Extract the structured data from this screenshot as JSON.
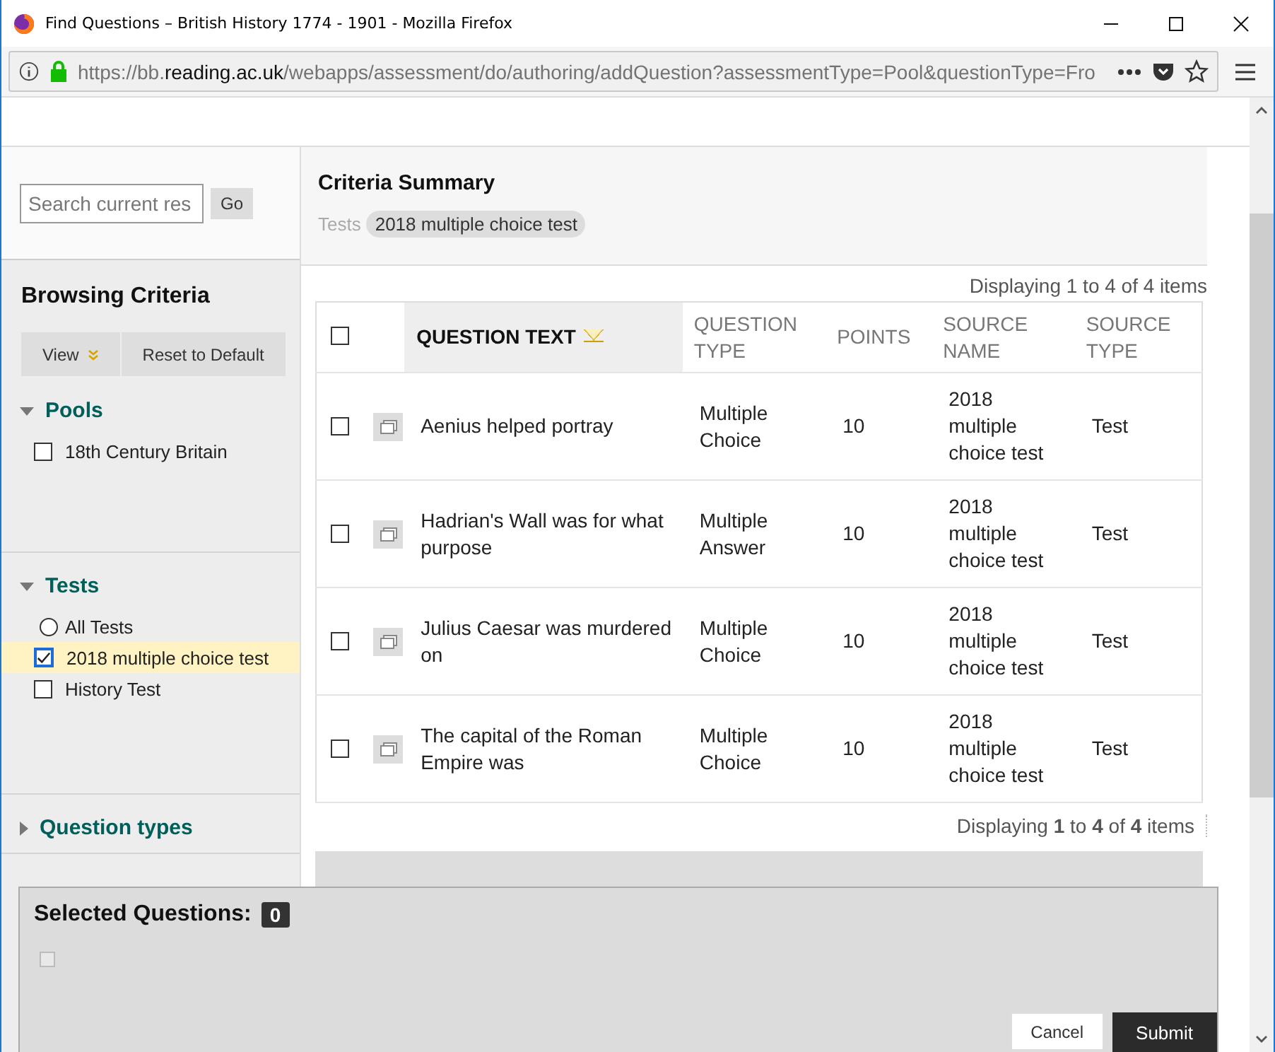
{
  "window": {
    "title": "Find Questions – British History 1774 - 1901 - Mozilla Firefox"
  },
  "address_bar": {
    "url_start": "https://bb.",
    "url_domain": "reading.ac.uk",
    "url_rest": "/webapps/assessment/do/authoring/addQuestion?assessmentType=Pool&questionType=Fro"
  },
  "sidebar": {
    "search": {
      "placeholder": "Search current res",
      "button": "Go"
    },
    "title": "Browsing Criteria",
    "buttons": [
      {
        "label": "View",
        "kind": "menu"
      },
      {
        "label": "Reset to Default",
        "kind": "plain"
      }
    ],
    "sections": [
      {
        "title": "Pools",
        "expanded": true,
        "items": [
          {
            "kind": "checkbox",
            "label": "18th Century Britain",
            "checked": false
          }
        ]
      },
      {
        "title": "Tests",
        "expanded": true,
        "items": [
          {
            "kind": "radio",
            "label": "All Tests",
            "checked": false
          },
          {
            "kind": "checkbox",
            "label": "2018 multiple choice test",
            "checked": true
          },
          {
            "kind": "checkbox",
            "label": "History Test",
            "checked": false
          }
        ]
      },
      {
        "title": "Question types",
        "expanded": false
      }
    ]
  },
  "criteria_summary": {
    "title": "Criteria Summary",
    "filters": [
      {
        "label": "Tests",
        "value": "2018 multiple choice test"
      }
    ]
  },
  "paging_top": "Displaying 1 to 4 of 4 items",
  "table": {
    "all_checked": false,
    "columns": [
      {
        "label": "QUESTION TEXT",
        "sorted": true
      },
      {
        "label": "QUESTION TYPE",
        "sorted": false
      },
      {
        "label": "POINTS",
        "sorted": false
      },
      {
        "label": "SOURCE NAME",
        "sorted": false
      },
      {
        "label": "SOURCE TYPE",
        "sorted": false
      }
    ],
    "rows": [
      {
        "checked": false,
        "cells": [
          "Aenius helped portray",
          "Multiple Choice",
          "10",
          "2018 multiple choice test",
          "Test"
        ]
      },
      {
        "checked": false,
        "cells": [
          "Hadrian's Wall was for what purpose",
          "Multiple Answer",
          "10",
          "2018 multiple choice test",
          "Test"
        ]
      },
      {
        "checked": false,
        "cells": [
          "Julius Caesar was murdered on",
          "Multiple Choice",
          "10",
          "2018 multiple choice test",
          "Test"
        ]
      },
      {
        "checked": false,
        "cells": [
          "The capital of the Roman Empire was",
          "Multiple Choice",
          "10",
          "2018 multiple choice test",
          "Test"
        ]
      }
    ]
  },
  "paging_bottom": "Displaying **1** to **4** of **4** items",
  "selection_panel": {
    "label": "Selected Questions:",
    "count": "0",
    "select_all_checked": false,
    "buttons": [
      {
        "label": "Cancel",
        "kind": "secondary"
      },
      {
        "label": "Submit",
        "kind": "primary"
      }
    ]
  }
}
